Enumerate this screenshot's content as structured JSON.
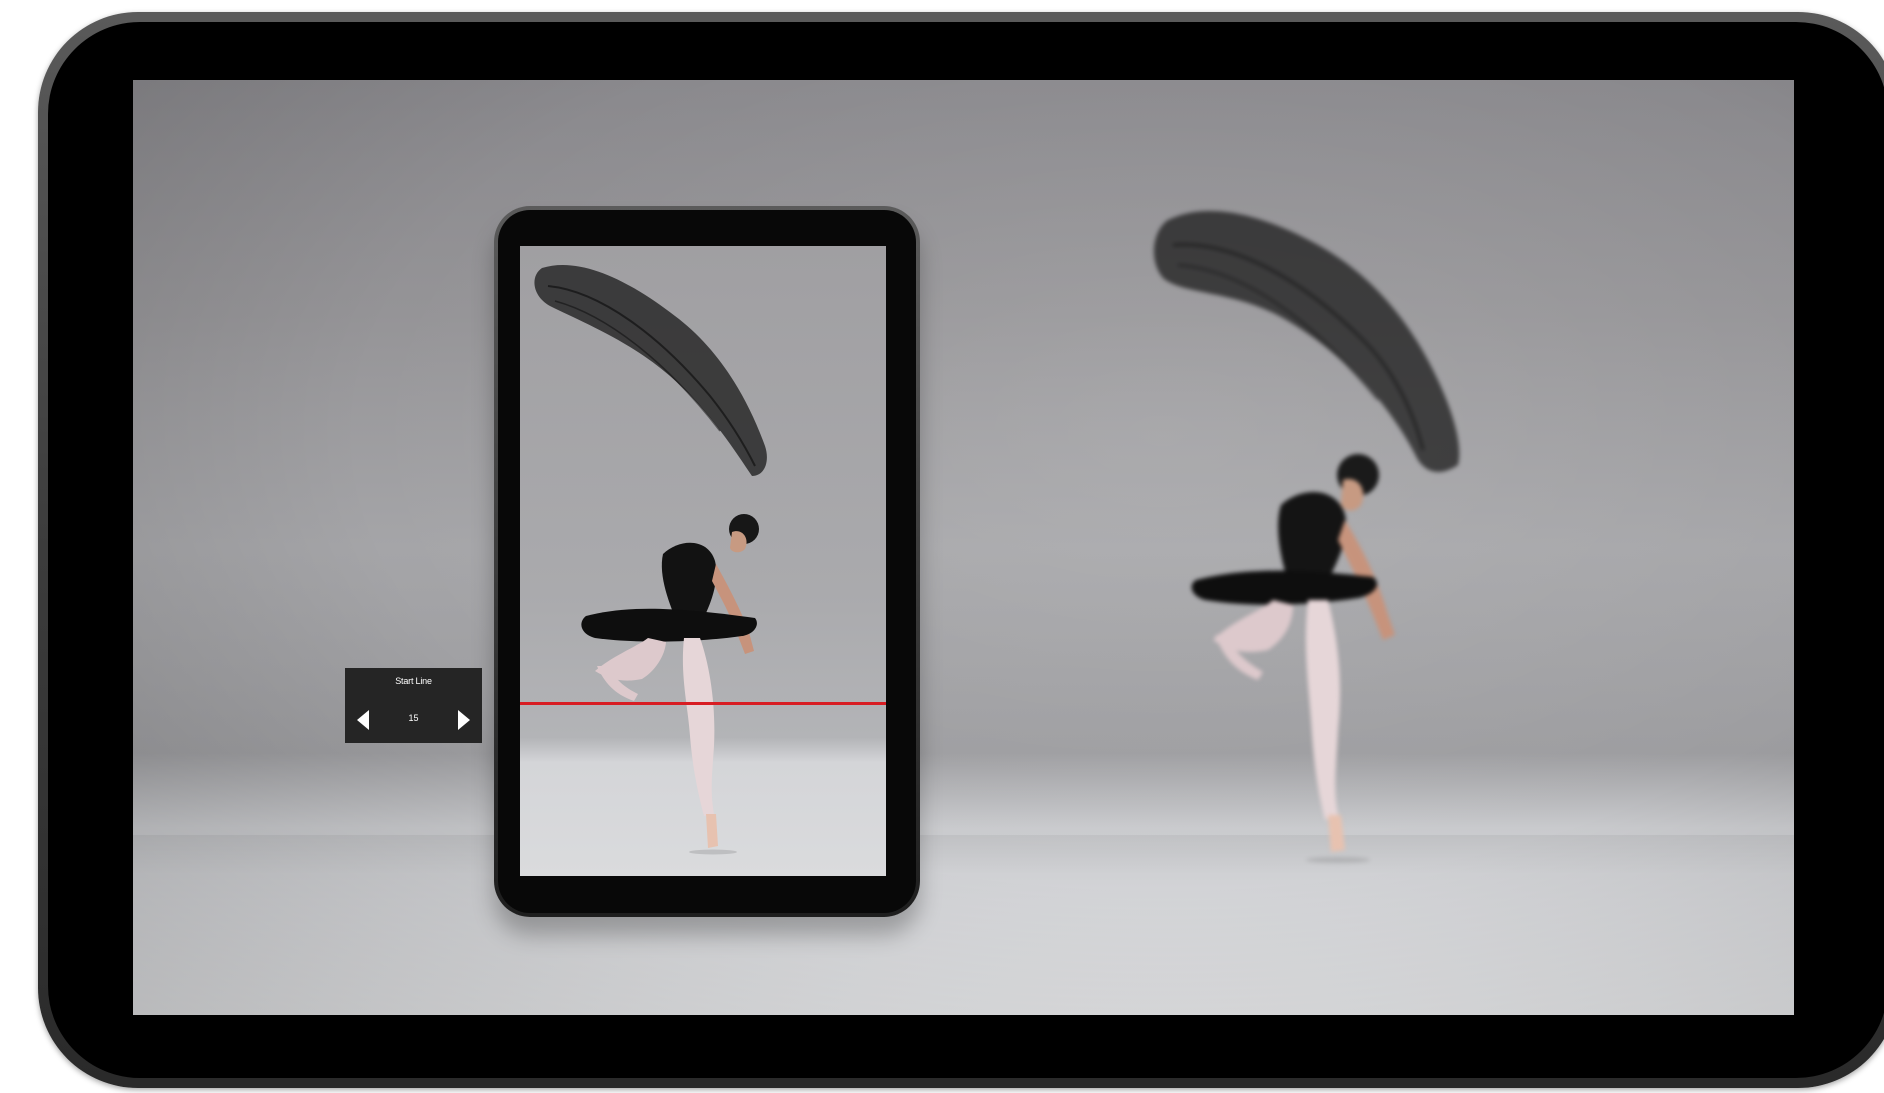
{
  "start_line_panel": {
    "title": "Start Line",
    "value": "15",
    "decrement_icon": "triangle-left-icon",
    "increment_icon": "triangle-right-icon"
  },
  "colors": {
    "start_line": "#d81d23",
    "panel_bg": "#252525"
  }
}
